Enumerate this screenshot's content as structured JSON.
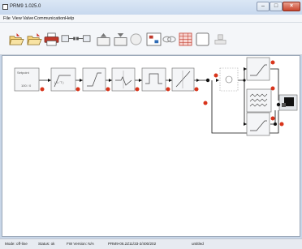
{
  "window": {
    "title": "PRM9 1.025.0"
  },
  "menu": [
    "File",
    "View",
    "Valve",
    "Communication",
    "Help"
  ],
  "toolbar_icons": [
    "open-folder-icon",
    "save-folder-icon",
    "print-icon",
    "send-icon",
    "receive-icon",
    "upload-icon",
    "download-icon",
    "disabled-circle-icon",
    "tune-icon",
    "link-icon",
    "grid-calculator-icon",
    "blank-panel-icon",
    "stamp-icon"
  ],
  "diagram": {
    "setpoint_label": "Setpoint",
    "setpoint_value": "100 / 0",
    "ramp_label": "( 1 / T )",
    "status_dot_color": "#d8341b",
    "block_border_color": "#7a7a7a",
    "line_color": "#111111"
  },
  "status": {
    "mode": "Mode: off-line",
    "status": "Status: ok",
    "fw": "FW Version: N/A",
    "part": "PRM9-06.2Z11/33-2/400/202",
    "file": "untitled"
  }
}
